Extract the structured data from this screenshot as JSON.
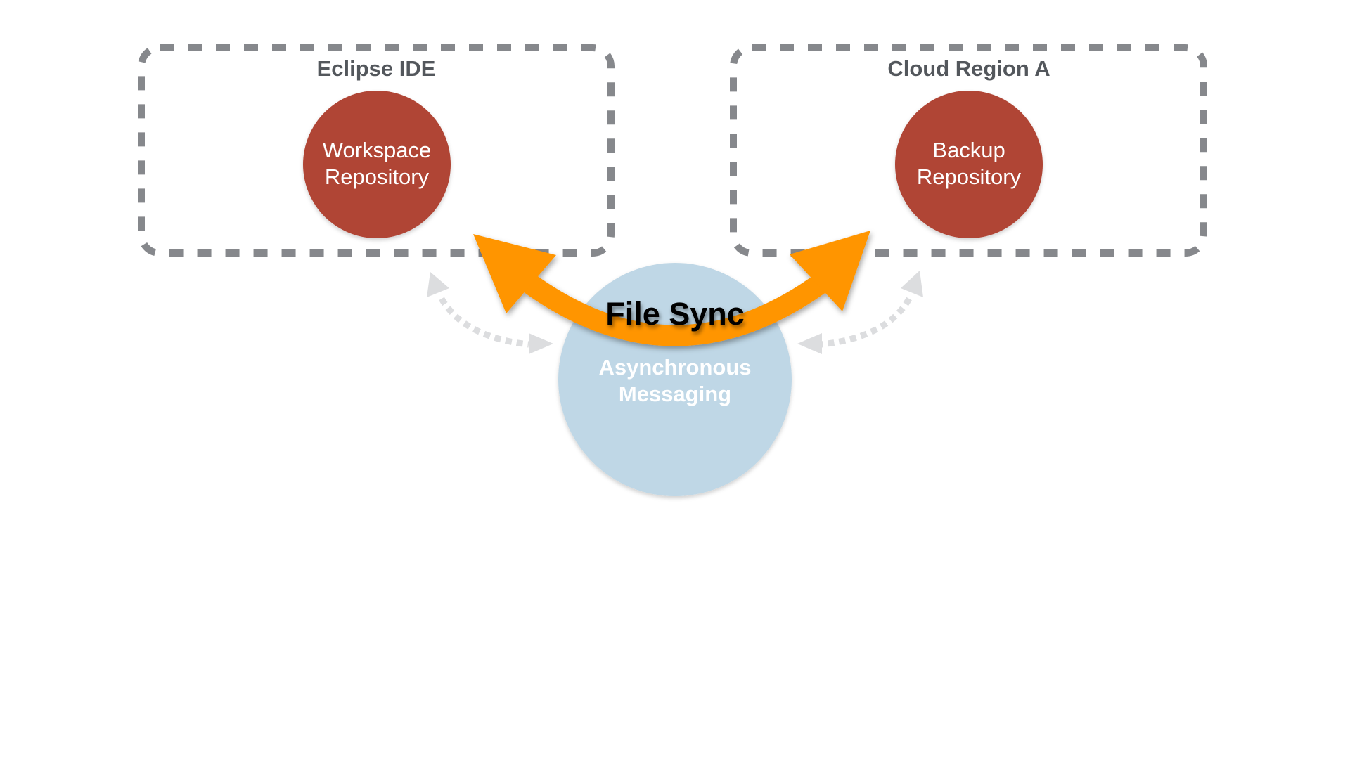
{
  "diagram": {
    "containers": [
      {
        "id": "eclipse-ide",
        "title": "Eclipse IDE",
        "node": {
          "lines": [
            "Workspace",
            "Repository"
          ]
        }
      },
      {
        "id": "cloud-region-a",
        "title": "Cloud Region A",
        "node": {
          "lines": [
            "Backup",
            "Repository"
          ]
        }
      }
    ],
    "hub": {
      "lines": [
        "Asynchronous",
        "Messaging"
      ]
    },
    "sync_arrow": {
      "label": "File Sync",
      "direction": "bidirectional"
    },
    "messaging_links": [
      {
        "from": "eclipse-ide",
        "to": "hub",
        "style": "dotted",
        "direction": "bidirectional"
      },
      {
        "from": "cloud-region-a",
        "to": "hub",
        "style": "dotted",
        "direction": "bidirectional"
      }
    ],
    "colors": {
      "container_border": "#86888c",
      "title_text": "#53575c",
      "repo_fill": "#b04434",
      "hub_fill": "#bfd7e6",
      "sync_arrow": "#ff9500",
      "dotted_link": "#dcdddf"
    }
  }
}
